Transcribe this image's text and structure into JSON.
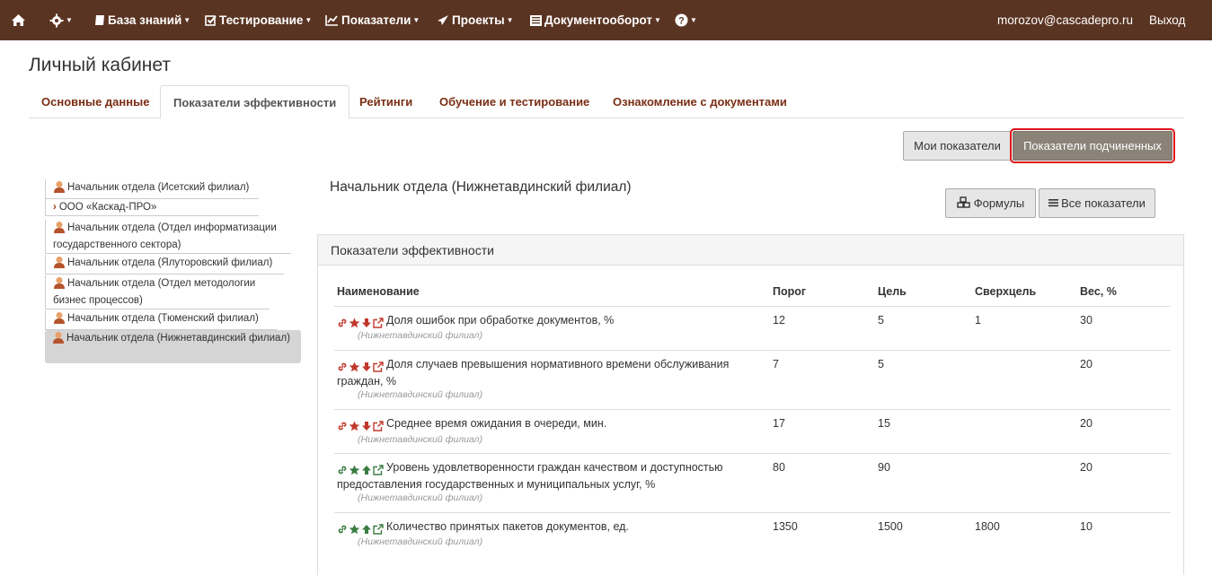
{
  "navbar": {
    "items": [
      {
        "label": ""
      },
      {
        "label": ""
      },
      {
        "label": "База знаний"
      },
      {
        "label": "Тестирование"
      },
      {
        "label": "Показатели"
      },
      {
        "label": "Проекты"
      },
      {
        "label": "Документооборот"
      },
      {
        "label": ""
      }
    ],
    "user": "morozov@cascadepro.ru",
    "logout": "Выход"
  },
  "page": {
    "title": "Личный кабинет"
  },
  "tabs": [
    {
      "label": "Основные данные"
    },
    {
      "label": "Показатели эффективности"
    },
    {
      "label": "Рейтинги"
    },
    {
      "label": "Обучение и тестирование"
    },
    {
      "label": "Ознакомление с документами"
    }
  ],
  "view_toggle": {
    "mine": "Мои показатели",
    "subordinates": "Показатели подчиненных"
  },
  "tree": [
    {
      "label": "Начальник отдела (Исетский филиал)"
    },
    {
      "label": "ООО «Каскад-ПРО»"
    },
    {
      "label": "Начальник отдела (Отдел информатизации государственного сектора)"
    },
    {
      "label": "Начальник отдела (Ялуторовский филиал)"
    },
    {
      "label": "Начальник отдела (Отдел методологии бизнес процессов)"
    },
    {
      "label": "Начальник отдела (Тюменский филиал)"
    },
    {
      "label": "Начальник отдела (Нижнетавдинский филиал)"
    }
  ],
  "employee": {
    "title": "Начальник отдела (Нижнетавдинский филиал)"
  },
  "actions": {
    "formulas": "Формулы",
    "all": "Все показатели"
  },
  "panel": {
    "title": "Показатели эффективности"
  },
  "table": {
    "headers": [
      "Наименование",
      "Порог",
      "Цель",
      "Сверхцель",
      "Вес, %"
    ],
    "rows": [
      {
        "name": "Доля ошибок при обработке документов, %",
        "dept": "(Нижнетавдинский филиал)",
        "threshold": "12",
        "target": "5",
        "super": "1",
        "weight": "30",
        "trend": "down"
      },
      {
        "name": "Доля случаев превышения нормативного времени обслуживания граждан, %",
        "dept": "(Нижнетавдинский филиал)",
        "threshold": "7",
        "target": "5",
        "super": "",
        "weight": "20",
        "trend": "down"
      },
      {
        "name": "Среднее время ожидания в очереди, мин.",
        "dept": "(Нижнетавдинский филиал)",
        "threshold": "17",
        "target": "15",
        "super": "",
        "weight": "20",
        "trend": "down"
      },
      {
        "name": "Уровень удовлетворенности граждан качеством и доступностью предоставления государственных и муниципальных услуг, %",
        "dept": "(Нижнетавдинский филиал)",
        "threshold": "80",
        "target": "90",
        "super": "",
        "weight": "20",
        "trend": "up"
      },
      {
        "name": "Количество принятых пакетов документов, ед.",
        "dept": "(Нижнетавдинский филиал)",
        "threshold": "1350",
        "target": "1500",
        "super": "1800",
        "weight": "10",
        "trend": "up"
      }
    ]
  },
  "colors": {
    "navbar": "#5a3422",
    "down": "#c0392b",
    "up": "#3a7d44",
    "tab_text": "#7a2e14"
  }
}
